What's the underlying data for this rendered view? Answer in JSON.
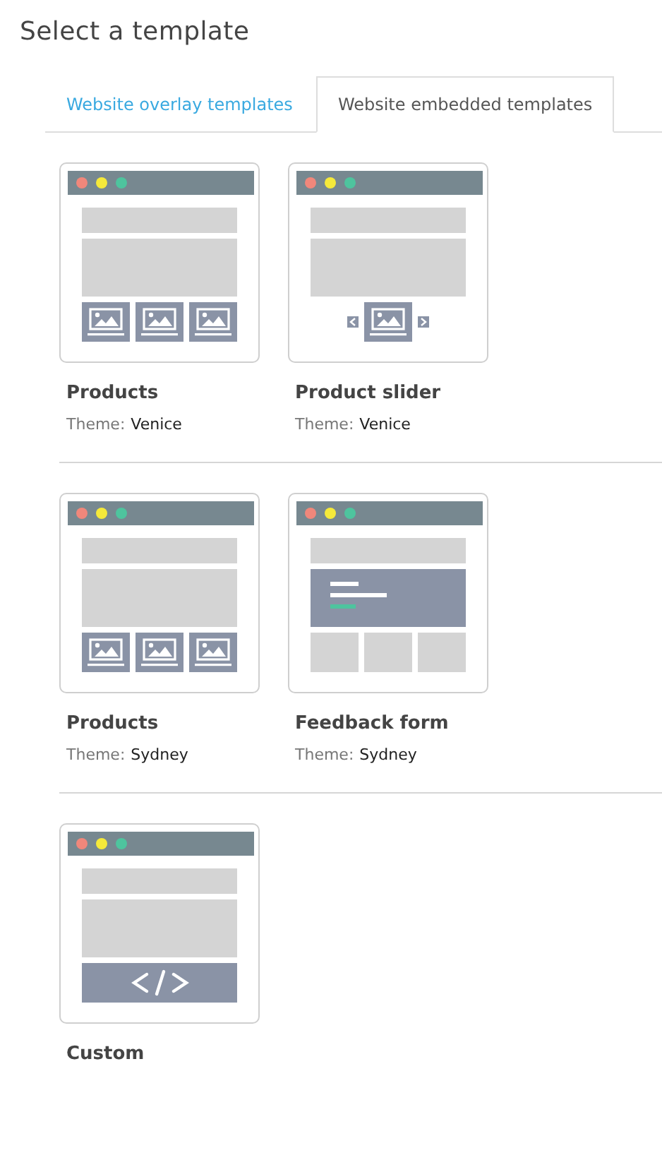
{
  "title": "Select a template",
  "tabs": [
    {
      "label": "Website overlay templates",
      "selected": false
    },
    {
      "label": "Website embedded templates",
      "selected": true
    }
  ],
  "sections": [
    {
      "templates": [
        {
          "kind": "products",
          "name": "Products",
          "theme_label": "Theme:",
          "theme": "Venice"
        },
        {
          "kind": "slider",
          "name": "Product slider",
          "theme_label": "Theme:",
          "theme": "Venice"
        }
      ]
    },
    {
      "templates": [
        {
          "kind": "products",
          "name": "Products",
          "theme_label": "Theme:",
          "theme": "Sydney"
        },
        {
          "kind": "form",
          "name": "Feedback form",
          "theme_label": "Theme:",
          "theme": "Sydney"
        }
      ]
    },
    {
      "templates": [
        {
          "kind": "custom",
          "name": "Custom"
        }
      ]
    }
  ]
}
